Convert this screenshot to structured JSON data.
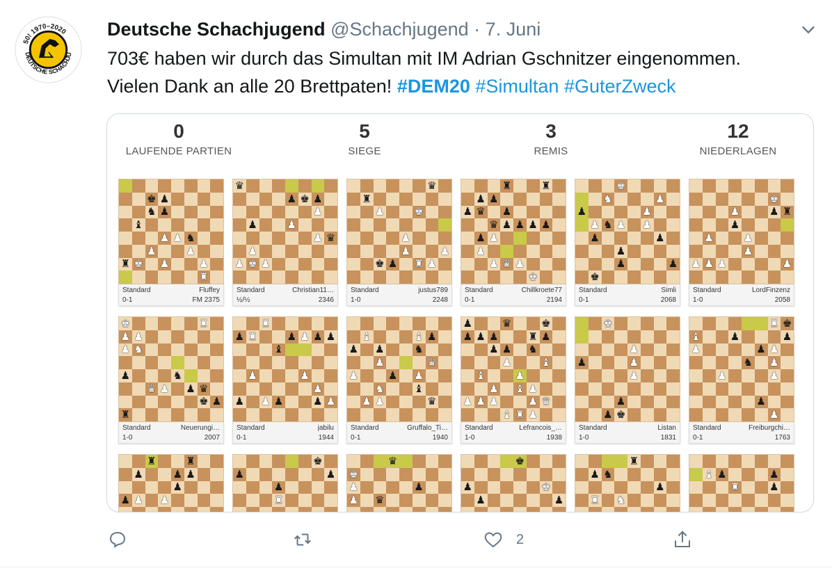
{
  "tweet": {
    "author_name": "Deutsche Schachjugend",
    "handle": "@Schachjugend",
    "separator": "·",
    "date": "7. Juni",
    "text_line1": "703€ haben wir durch das Simultan mit IM Adrian Gschnitzer eingenommen.",
    "text_line2_prefix": "Vielen Dank an alle 20 Brettpaten!",
    "hashtags": [
      "#DEM20",
      "#Simultan",
      "#GuterZweck"
    ]
  },
  "avatar": {
    "logo_top": "50! 1970–2020",
    "logo_bottom": "DEUTSCHE SCHACHJUGEND"
  },
  "card": {
    "stats": [
      {
        "value": "0",
        "label": "LAUFENDE PARTIEN"
      },
      {
        "value": "5",
        "label": "SIEGE"
      },
      {
        "value": "3",
        "label": "REMIS"
      },
      {
        "value": "12",
        "label": "NIEDERLAGEN"
      }
    ],
    "games": [
      {
        "type": "Standard",
        "result": "0-1",
        "player": "Fluffey",
        "rating": "FM 2375"
      },
      {
        "type": "Standard",
        "result": "½/½",
        "player": "Christian11…",
        "rating": "2346"
      },
      {
        "type": "Standard",
        "result": "1-0",
        "player": "justus789",
        "rating": "2248"
      },
      {
        "type": "Standard",
        "result": "0-1",
        "player": "Chillkroete77",
        "rating": "2194"
      },
      {
        "type": "Standard",
        "result": "0-1",
        "player": "Simli",
        "rating": "2068"
      },
      {
        "type": "Standard",
        "result": "1-0",
        "player": "LordFinzenz",
        "rating": "2058"
      },
      {
        "type": "Standard",
        "result": "1-0",
        "player": "Neuerungi…",
        "rating": "2007"
      },
      {
        "type": "Standard",
        "result": "0-1",
        "player": "jabilu",
        "rating": "1944"
      },
      {
        "type": "Standard",
        "result": "0-1",
        "player": "Gruffalo_Ti…",
        "rating": "1940"
      },
      {
        "type": "Standard",
        "result": "1-0",
        "player": "Lefrancois_…",
        "rating": "1938"
      },
      {
        "type": "Standard",
        "result": "1-0",
        "player": "Listan",
        "rating": "1831"
      },
      {
        "type": "Standard",
        "result": "0-1",
        "player": "Freiburgchi…",
        "rating": "1763"
      },
      {},
      {},
      {},
      {},
      {},
      {}
    ],
    "boards": [
      [
        "h.......",
        "..kp....",
        "..np....",
        ".b......",
        "...PPn..",
        "..P..P..",
        "rK.P..P.",
        "......R."
      ],
      [
        "q...h...",
        "....pkp.",
        "......P.",
        ".p..P...",
        "......Pq",
        ".P......",
        "PKP.....",
        "........"
      ],
      [
        "......q.",
        ".r......",
        "..P..K..",
        "........",
        "....P...",
        "....P..P",
        "..kp.RP.",
        "........"
      ],
      [
        "...r..r.",
        ".pp.....",
        "pq.p....",
        "..qpppp.",
        ".pP.....",
        ".P.h....",
        "..PQP...",
        ".....K.."
      ],
      [
        "...K....",
        "h.N...P.",
        "p....P..",
        ".PnP.P..",
        ".p....p.",
        "...p....",
        "...p...p",
        ".k......"
      ],
      [
        "........",
        "......K.",
        "...P..pr",
        "...p...h",
        ".P..P...",
        "....P...",
        "PPP....P",
        "........"
      ],
      [
        "K.....R.",
        "PP......",
        "PN......",
        "....h...",
        "p...n...",
        "..QP.pq.",
        "......kp",
        "r......."
      ],
      [
        "..R.....",
        "pR..pPpp",
        "...b.h..",
        "........",
        ".P...P..",
        "......P.",
        "p.Pp..pP",
        "........"
      ],
      [
        "........",
        ".B...Bp.",
        "p.p..n..",
        "..P.h.Q.",
        "P..p.P..",
        "..N..b..",
        ".PP...q.",
        "........"
      ],
      [
        "p..q..k.",
        "ppp..rp.",
        "..pp.n..",
        "...P..B.",
        ".B..P...",
        "..P.BP..",
        "PPP..PQ.",
        "...BRP.."
      ],
      [
        "h.K.....",
        "h.......",
        "....P...",
        "p...P...",
        "....P...",
        "........",
        "...p....",
        "..pk...."
      ],
      [
        ".....hRk",
        "B..p...p",
        "P....pP.",
        "....n.P.",
        "..P...P.",
        "........",
        ".....p..",
        "......P."
      ],
      [
        "..r..r..",
        ".p..pp..",
        "....p...",
        "pP.P....",
        "........",
        "........",
        "........",
        "........"
      ],
      [
        "......k.",
        "p......p",
        "...p....",
        "...R....",
        "........",
        "........",
        "........",
        "........"
      ],
      [
        "..hq....",
        "K.......",
        "P....p..",
        "P.q.....",
        "........",
        "........",
        "........",
        "........"
      ],
      [
        "...hk...",
        "........",
        "p.....K.",
        ".p.....p",
        "........",
        "........",
        "........",
        "........"
      ],
      [
        "...hr...",
        ".pn.....",
        "......p.",
        ".R.N....",
        "........",
        "........",
        "........",
        "........"
      ],
      [
        "........",
        "hBp...p.",
        "...R..p.",
        "........",
        "........",
        "........",
        "........",
        "........"
      ]
    ],
    "highlights": [
      [
        [
          0,
          0
        ],
        [
          7,
          0
        ]
      ],
      [
        [
          0,
          6
        ]
      ],
      [
        [
          3,
          7
        ]
      ],
      [
        [
          4,
          4
        ]
      ],
      [
        [
          2,
          0
        ],
        [
          3,
          0
        ]
      ],
      [
        [
          3,
          7
        ]
      ],
      [
        [
          4,
          5
        ]
      ],
      [
        [
          2,
          4
        ]
      ],
      [
        [
          3,
          4
        ]
      ],
      [
        [
          4,
          4
        ]
      ],
      [
        [
          0,
          0
        ],
        [
          1,
          0
        ]
      ],
      [
        [
          0,
          4
        ]
      ],
      [
        [
          0,
          2
        ]
      ],
      [
        [
          0,
          4
        ]
      ],
      [
        [
          0,
          3
        ],
        [
          0,
          4
        ]
      ],
      [
        [
          0,
          4
        ]
      ],
      [
        [
          0,
          2
        ]
      ],
      [
        [
          1,
          0
        ]
      ]
    ]
  },
  "actions": {
    "reply": {
      "icon": "reply-icon"
    },
    "retweet": {
      "icon": "retweet-icon"
    },
    "like": {
      "icon": "heart-icon",
      "count": "2"
    },
    "share": {
      "icon": "share-icon"
    }
  },
  "colors": {
    "link": "#1b95e0",
    "text": "#14171a",
    "muted": "#657786",
    "board_light": "#f0d9b5",
    "board_dark": "#c8925c",
    "board_highlight": "#c9c94a"
  }
}
